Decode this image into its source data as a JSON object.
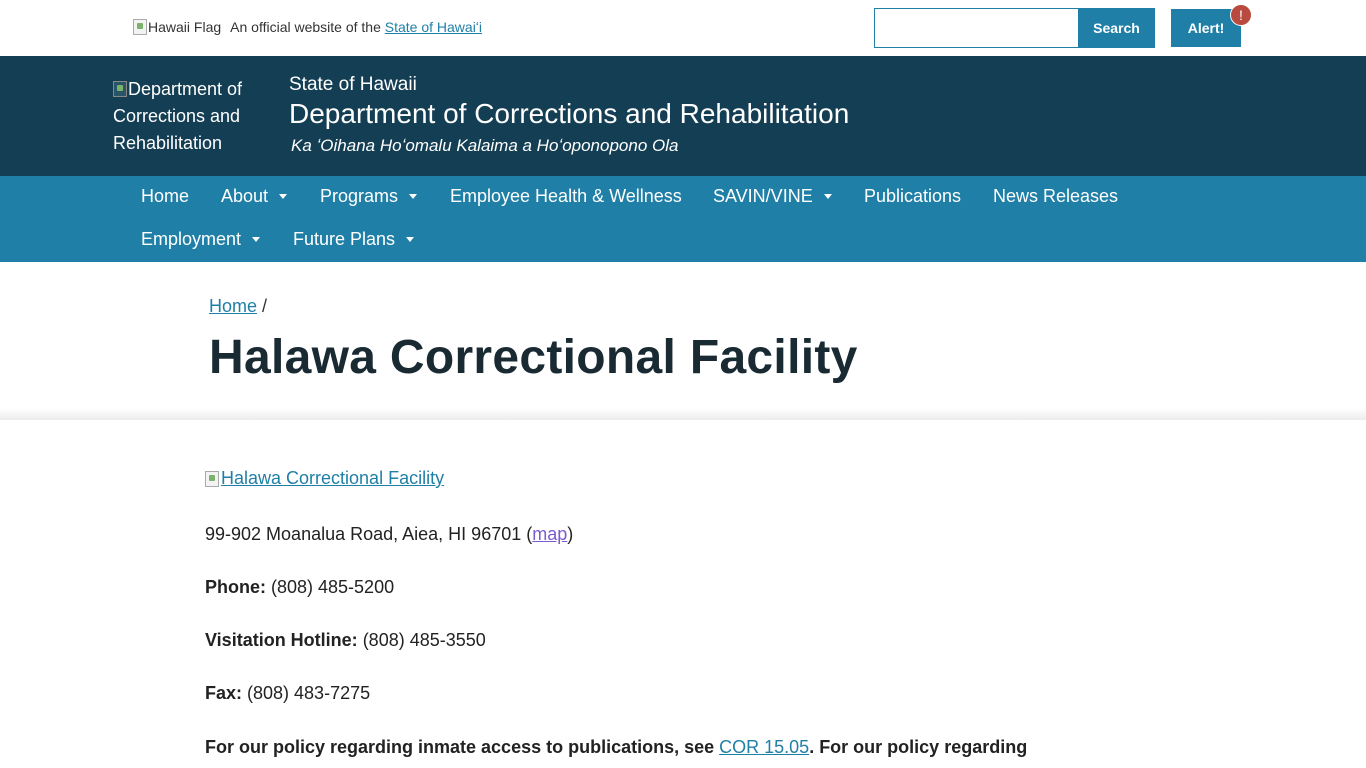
{
  "topbar": {
    "flag_alt": "Hawaii Flag",
    "official_prefix": "An official website of the",
    "official_link": "State of Hawaiʻi",
    "search_placeholder": "",
    "search_button": "Search",
    "alert_button": "Alert!",
    "alert_badge": "!"
  },
  "header": {
    "logo_alt": "Department of Corrections and Rehabilitation",
    "state": "State of Hawaii",
    "department": "Department of Corrections and Rehabilitation",
    "subtitle": "Ka ʻOihana Hoʻomalu Kalaima a Hoʻoponopono Ola"
  },
  "nav": {
    "items": [
      {
        "label": "Home"
      },
      {
        "label": "About"
      },
      {
        "label": "Programs"
      },
      {
        "label": "Employee Health & Wellness"
      },
      {
        "label": "SAVIN/VINE"
      },
      {
        "label": "Publications"
      },
      {
        "label": "News Releases"
      },
      {
        "label": "Employment"
      },
      {
        "label": "Future Plans"
      }
    ]
  },
  "breadcrumb": {
    "home": "Home",
    "separator": "/"
  },
  "page": {
    "title": "Halawa Correctional Facility"
  },
  "content": {
    "image_alt": "Halawa Correctional Facility",
    "address": "99-902 Moanalua Road, Aiea, HI 96701 (",
    "map_link": "map",
    "address_close": ")",
    "phone_label": "Phone:",
    "phone_value": " (808) 485-5200",
    "visitation_label": "Visitation Hotline:",
    "visitation_value": " (808) 485-3550",
    "fax_label": "Fax:",
    "fax_value": " (808) 483-7275",
    "policy_prefix": "For our policy regarding inmate access to publications, see ",
    "policy_link": "COR 15.05",
    "policy_suffix": ". For our policy regarding"
  },
  "colors": {
    "header_bg": "#133e53",
    "nav_bg": "#1f7fa6",
    "link": "#1f7fa6",
    "alert_badge": "#b94a3f"
  }
}
